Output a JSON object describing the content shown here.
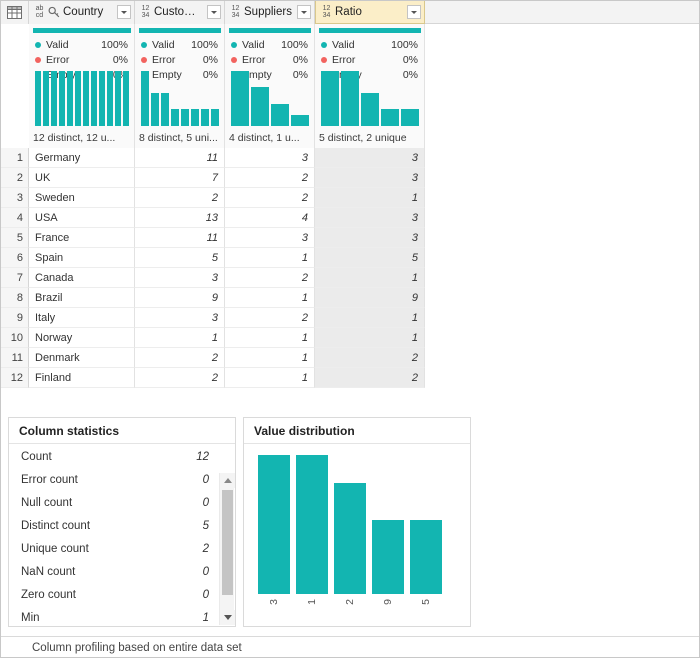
{
  "accent_color": "#13b5b1",
  "error_color": "#f2635f",
  "empty_color": "#555555",
  "selected_header_bg": "#fbeec8",
  "corner": {
    "icon": "table-grid-icon"
  },
  "columns": [
    {
      "name": "Country",
      "type_icon": "abc-text-type-icon",
      "type_top": "ab",
      "type_bottom": "cd",
      "has_key_icon": true,
      "key_icon": "key-icon",
      "selected": false,
      "quality": [
        {
          "label": "Valid",
          "value": "100%",
          "color": "#13b5b1"
        },
        {
          "label": "Error",
          "value": "0%",
          "color": "#f2635f"
        },
        {
          "label": "Empty",
          "value": "0%",
          "color": "#555555"
        }
      ],
      "distribution_text": "12 distinct, 12 u...",
      "distribution_bars": [
        10,
        10,
        10,
        10,
        10,
        10,
        10,
        10,
        10,
        10,
        10,
        10
      ]
    },
    {
      "name": "Customers",
      "type_icon": "123-number-type-icon",
      "type_top": "12",
      "type_bottom": "34",
      "has_key_icon": false,
      "selected": false,
      "quality": [
        {
          "label": "Valid",
          "value": "100%",
          "color": "#13b5b1"
        },
        {
          "label": "Error",
          "value": "0%",
          "color": "#f2635f"
        },
        {
          "label": "Empty",
          "value": "0%",
          "color": "#555555"
        }
      ],
      "distribution_text": "8 distinct, 5 uni...",
      "distribution_bars": [
        10,
        6,
        6,
        3,
        3,
        3,
        3,
        3
      ]
    },
    {
      "name": "Suppliers",
      "type_icon": "123-number-type-icon",
      "type_top": "12",
      "type_bottom": "34",
      "has_key_icon": false,
      "selected": false,
      "quality": [
        {
          "label": "Valid",
          "value": "100%",
          "color": "#13b5b1"
        },
        {
          "label": "Error",
          "value": "0%",
          "color": "#f2635f"
        },
        {
          "label": "Empty",
          "value": "0%",
          "color": "#555555"
        }
      ],
      "distribution_text": "4 distinct, 1 u...",
      "distribution_bars": [
        10,
        7,
        4,
        2
      ]
    },
    {
      "name": "Ratio",
      "type_icon": "123-number-type-icon",
      "type_top": "12",
      "type_bottom": "34",
      "has_key_icon": false,
      "selected": true,
      "quality": [
        {
          "label": "Valid",
          "value": "100%",
          "color": "#13b5b1"
        },
        {
          "label": "Error",
          "value": "0%",
          "color": "#f2635f"
        },
        {
          "label": "Empty",
          "value": "0%",
          "color": "#555555"
        }
      ],
      "distribution_text": "5 distinct, 2 unique",
      "distribution_bars": [
        10,
        10,
        6,
        3,
        3
      ]
    }
  ],
  "rows": [
    {
      "num": "1",
      "country": "Germany",
      "customers": "11",
      "suppliers": "3",
      "ratio": "3"
    },
    {
      "num": "2",
      "country": "UK",
      "customers": "7",
      "suppliers": "2",
      "ratio": "3"
    },
    {
      "num": "3",
      "country": "Sweden",
      "customers": "2",
      "suppliers": "2",
      "ratio": "1"
    },
    {
      "num": "4",
      "country": "USA",
      "customers": "13",
      "suppliers": "4",
      "ratio": "3"
    },
    {
      "num": "5",
      "country": "France",
      "customers": "11",
      "suppliers": "3",
      "ratio": "3"
    },
    {
      "num": "6",
      "country": "Spain",
      "customers": "5",
      "suppliers": "1",
      "ratio": "5"
    },
    {
      "num": "7",
      "country": "Canada",
      "customers": "3",
      "suppliers": "2",
      "ratio": "1"
    },
    {
      "num": "8",
      "country": "Brazil",
      "customers": "9",
      "suppliers": "1",
      "ratio": "9"
    },
    {
      "num": "9",
      "country": "Italy",
      "customers": "3",
      "suppliers": "2",
      "ratio": "1"
    },
    {
      "num": "10",
      "country": "Norway",
      "customers": "1",
      "suppliers": "1",
      "ratio": "1"
    },
    {
      "num": "11",
      "country": "Denmark",
      "customers": "2",
      "suppliers": "1",
      "ratio": "2"
    },
    {
      "num": "12",
      "country": "Finland",
      "customers": "2",
      "suppliers": "1",
      "ratio": "2"
    }
  ],
  "column_statistics": {
    "title": "Column statistics",
    "items": [
      {
        "label": "Count",
        "value": "12"
      },
      {
        "label": "Error count",
        "value": "0"
      },
      {
        "label": "Null count",
        "value": "0"
      },
      {
        "label": "Distinct count",
        "value": "5"
      },
      {
        "label": "Unique count",
        "value": "2"
      },
      {
        "label": "NaN count",
        "value": "0"
      },
      {
        "label": "Zero count",
        "value": "0"
      },
      {
        "label": "Min",
        "value": "1"
      }
    ]
  },
  "value_distribution": {
    "title": "Value distribution"
  },
  "chart_data": {
    "type": "bar",
    "title": "Value distribution",
    "categories": [
      "3",
      "1",
      "2",
      "9",
      "5"
    ],
    "values": [
      4,
      4,
      3,
      2,
      2
    ],
    "xlabel": "",
    "ylabel": "",
    "ylim": [
      0,
      4
    ],
    "grid": false,
    "legend": false,
    "series_color": "#13b5b1"
  },
  "footer": {
    "text": "Column profiling based on entire data set"
  }
}
